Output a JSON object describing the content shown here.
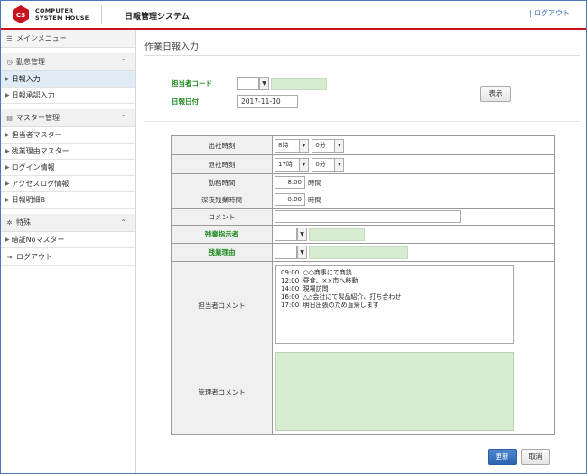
{
  "header": {
    "logo_line1": "COMPUTER",
    "logo_line2": "SYSTEM HOUSE",
    "system_title": "日報管理システム",
    "logout": "ログアウト"
  },
  "sidebar": {
    "main_menu": "メインメニュー",
    "groups": [
      {
        "label": "勤怠管理",
        "items": [
          "日報入力",
          "日報承認入力"
        ]
      },
      {
        "label": "マスター管理",
        "items": [
          "担当者マスター",
          "残業理由マスター",
          "ログイン情報",
          "アクセスログ情報",
          "日報明細B"
        ]
      },
      {
        "label": "特殊",
        "items": [
          "暗証Noマスター"
        ]
      }
    ],
    "logout": "ログアウト",
    "active_item": "日報入力"
  },
  "page": {
    "title": "作業日報入力",
    "staff_code_label": "担当者コード",
    "report_date_label": "日報日付",
    "report_date_value": "2017-11-10",
    "show_button": "表示"
  },
  "form": {
    "rows": {
      "clock_in": {
        "label": "出社時刻",
        "hour": "8時",
        "minute": "0分"
      },
      "clock_out": {
        "label": "退社時刻",
        "hour": "17時",
        "minute": "0分"
      },
      "work_hours": {
        "label": "勤務時間",
        "value": "8.00",
        "unit": "時間"
      },
      "late_overtime": {
        "label": "深夜残業時間",
        "value": "0.00",
        "unit": "時間"
      },
      "comment": {
        "label": "コメント",
        "value": ""
      },
      "overtime_instructor": {
        "label": "残業指示者"
      },
      "overtime_reason": {
        "label": "残業理由"
      },
      "staff_comment": {
        "label": "担当者コメント",
        "value": "09:00  ○○商事にて商談\n12:00  昼食、××市へ移動\n14:00  現場訪問\n16:00  △△会社にて製品紹介、打ち合わせ\n17:00  明日出張のため直帰します"
      },
      "manager_comment": {
        "label": "管理者コメント",
        "value": ""
      }
    }
  },
  "actions": {
    "update": "更新",
    "cancel": "取消"
  },
  "colors": {
    "accent_red": "#c8121d",
    "green_label": "#1e8a1e",
    "green_fill": "#d7ecd0",
    "primary_blue": "#2c63b2"
  }
}
